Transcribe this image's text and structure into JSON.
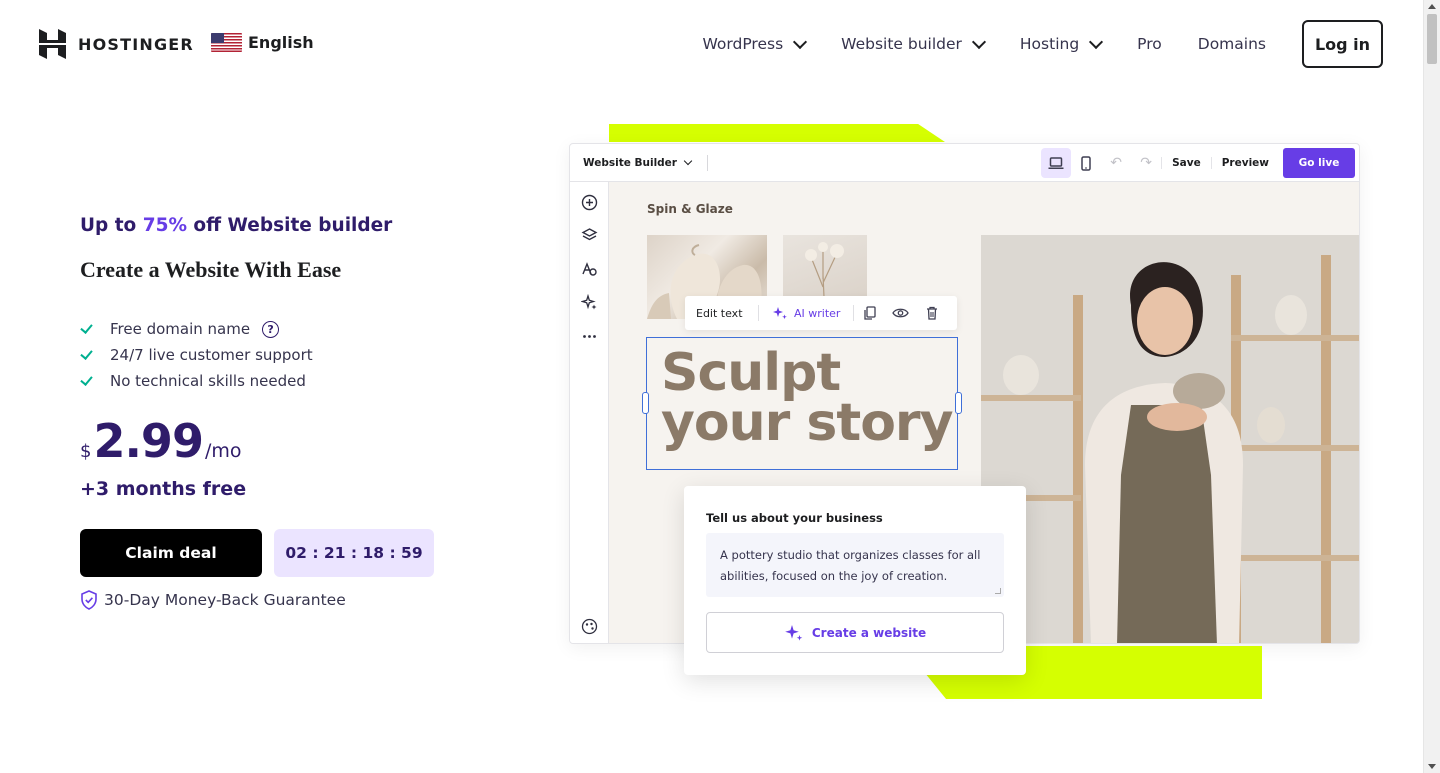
{
  "header": {
    "logo_text": "HOSTINGER",
    "language": "English",
    "nav": [
      {
        "label": "WordPress",
        "dropdown": true
      },
      {
        "label": "Website builder",
        "dropdown": true
      },
      {
        "label": "Hosting",
        "dropdown": true
      },
      {
        "label": "Pro",
        "dropdown": false
      },
      {
        "label": "Domains",
        "dropdown": false
      }
    ],
    "login_label": "Log in"
  },
  "hero": {
    "promo_prefix": "Up to ",
    "promo_percent": "75%",
    "promo_suffix": " off Website builder",
    "headline": "Create a Website With Ease",
    "features": [
      "Free domain name",
      "24/7 live customer support",
      "No technical skills needed"
    ],
    "price_currency": "$",
    "price_amount": "2.99",
    "price_period": "/mo",
    "bonus": "+3 months free",
    "cta_label": "Claim deal",
    "countdown": "02 : 21 : 18 : 59",
    "guarantee": "30-Day Money-Back Guarantee"
  },
  "builder": {
    "title": "Website Builder",
    "save_label": "Save",
    "preview_label": "Preview",
    "go_live_label": "Go live",
    "site_brand": "Spin & Glaze",
    "toolbar": {
      "edit_text": "Edit text",
      "ai_writer": "AI writer"
    },
    "headline_line1": "Sculpt",
    "headline_line2": "your story",
    "prompt_label": "Tell us about your business",
    "prompt_value": "A pottery studio that organizes classes for all abilities, focused on the joy of creation.",
    "create_label": "Create a website"
  },
  "colors": {
    "accent": "#673de6",
    "brand_dark": "#2f1c6a",
    "lime": "#d5ff01",
    "check": "#00b090"
  }
}
